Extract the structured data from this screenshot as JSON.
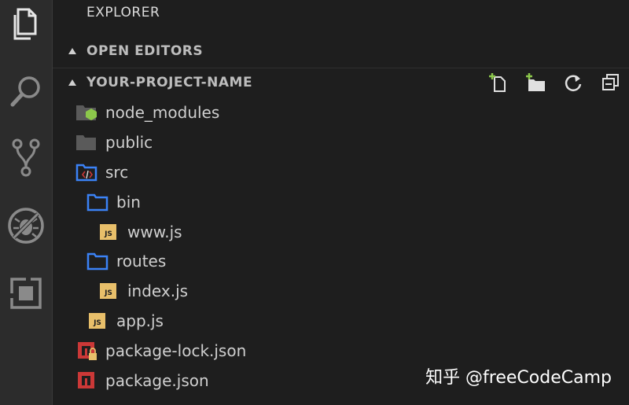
{
  "sidebar": {
    "title": "EXPLORER",
    "open_editors": "OPEN EDITORS",
    "project_name": "YOUR-PROJECT-NAME"
  },
  "activity_bar": [
    "files-icon",
    "search-icon",
    "source-control-icon",
    "debug-icon",
    "extensions-icon"
  ],
  "toolbar": [
    "new-file-icon",
    "new-folder-icon",
    "refresh-icon",
    "collapse-all-icon"
  ],
  "tree": [
    {
      "label": "node_modules",
      "icon": "node-folder-icon"
    },
    {
      "label": "public",
      "icon": "folder-icon"
    },
    {
      "label": "src",
      "icon": "src-folder-icon"
    },
    {
      "label": "bin",
      "icon": "folder-blue-icon"
    },
    {
      "label": "www.js",
      "icon": "js-file-icon"
    },
    {
      "label": "routes",
      "icon": "folder-blue-icon"
    },
    {
      "label": "index.js",
      "icon": "js-file-icon"
    },
    {
      "label": "app.js",
      "icon": "js-file-icon"
    },
    {
      "label": "package-lock.json",
      "icon": "npm-lock-icon"
    },
    {
      "label": "package.json",
      "icon": "npm-icon"
    }
  ],
  "colors": {
    "activity_bg": "#2c2c2c",
    "sidebar_bg": "#1e1e1e",
    "folder_blue": "#3b82f6",
    "js_yellow": "#e8bf6a",
    "npm_red": "#cb3837",
    "node_green": "#8cc84b"
  },
  "watermark": "知乎 @freeCodeCamp"
}
